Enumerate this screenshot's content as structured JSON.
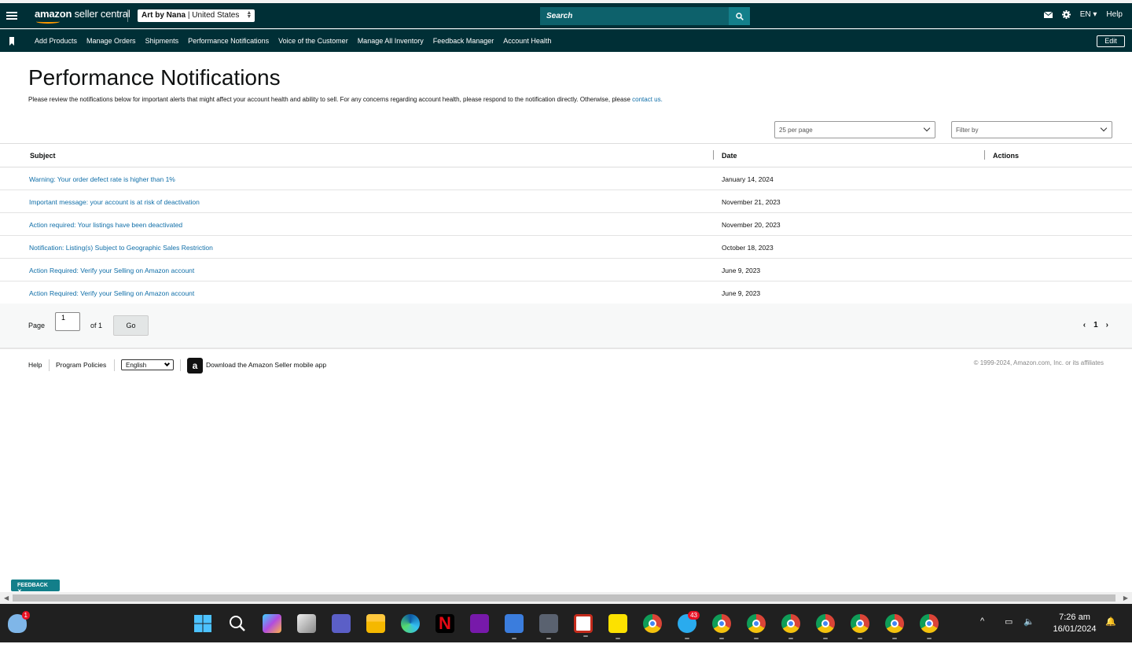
{
  "header": {
    "logo_word": "amazon",
    "logo_suffix": "seller central",
    "account_name": "Art by Nana",
    "account_region": "| United States",
    "search_placeholder": "Search",
    "language": "EN",
    "help": "Help"
  },
  "nav": {
    "items": [
      "Add Products",
      "Manage Orders",
      "Shipments",
      "Performance Notifications",
      "Voice of the Customer",
      "Manage All Inventory",
      "Feedback Manager",
      "Account Health"
    ],
    "edit": "Edit"
  },
  "page": {
    "title": "Performance Notifications",
    "description": "Please review the notifications below for important alerts that might affect your account health and ability to sell. For any concerns regarding account health, please respond to the notification directly. Otherwise, please",
    "contact_link": "contact us."
  },
  "controls": {
    "per_page": "25 per page",
    "filter_placeholder": "Filter by"
  },
  "table": {
    "headers": {
      "subject": "Subject",
      "date": "Date",
      "actions": "Actions"
    },
    "rows": [
      {
        "subject": "Warning: Your order defect rate is higher than 1%",
        "date": "January 14, 2024"
      },
      {
        "subject": "Important message: your account is at risk of deactivation",
        "date": "November 21, 2023"
      },
      {
        "subject": "Action required: Your listings have been deactivated",
        "date": "November 20, 2023"
      },
      {
        "subject": "Notification: Listing(s) Subject to Geographic Sales Restriction",
        "date": "October 18, 2023"
      },
      {
        "subject": "Action Required: Verify your Selling on Amazon account",
        "date": "June 9, 2023"
      },
      {
        "subject": "Action Required: Verify your Selling on Amazon account",
        "date": "June 9, 2023"
      }
    ]
  },
  "pagination": {
    "page_label": "Page",
    "page_value": "1",
    "of_label": "of 1",
    "go": "Go",
    "current": "1"
  },
  "footer": {
    "help": "Help",
    "program_policies": "Program Policies",
    "language": "English",
    "app_text": "Download the Amazon Seller mobile app",
    "copyright": "© 1999-2024, Amazon.com, Inc. or its affiliates"
  },
  "feedback": "FEEDBACK ✕",
  "taskbar": {
    "weather_badge": "1",
    "telegram_badge": "43",
    "time": "7:26 am",
    "date": "16/01/2024"
  },
  "colors": {
    "header_bg": "#002f36",
    "search_bg": "#0d616b",
    "link": "#0f6ea8",
    "accent": "#ff9900"
  }
}
